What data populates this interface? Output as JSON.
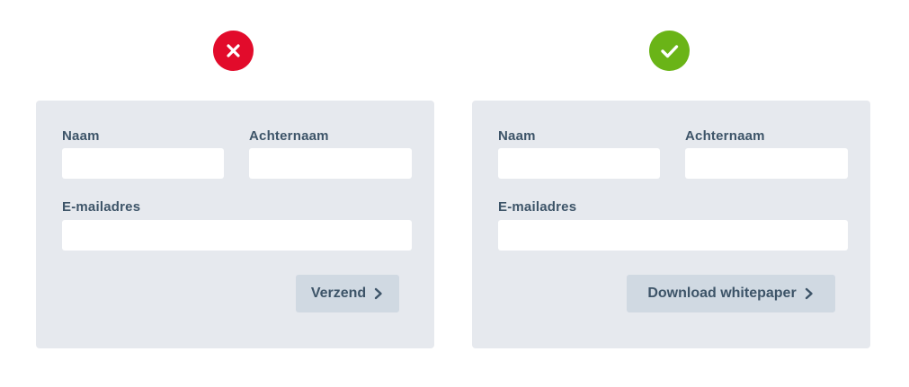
{
  "comparison": {
    "bad": {
      "status_icon": "cross-icon",
      "status_color": "#e20b2b",
      "form": {
        "first_name_label": "Naam",
        "last_name_label": "Achternaam",
        "email_label": "E-mailadres",
        "first_name_value": "",
        "last_name_value": "",
        "email_value": "",
        "submit_label": "Verzend",
        "submit_icon": "chevron-right-icon"
      }
    },
    "good": {
      "status_icon": "check-icon",
      "status_color": "#6ab417",
      "form": {
        "first_name_label": "Naam",
        "last_name_label": "Achternaam",
        "email_label": "E-mailadres",
        "first_name_value": "",
        "last_name_value": "",
        "email_value": "",
        "submit_label": "Download whitepaper",
        "submit_icon": "chevron-right-icon"
      }
    }
  },
  "colors": {
    "panel_bg": "#e6e9ee",
    "field_bg": "#ffffff",
    "button_bg": "#d0d9e2",
    "text": "#3d5468"
  }
}
